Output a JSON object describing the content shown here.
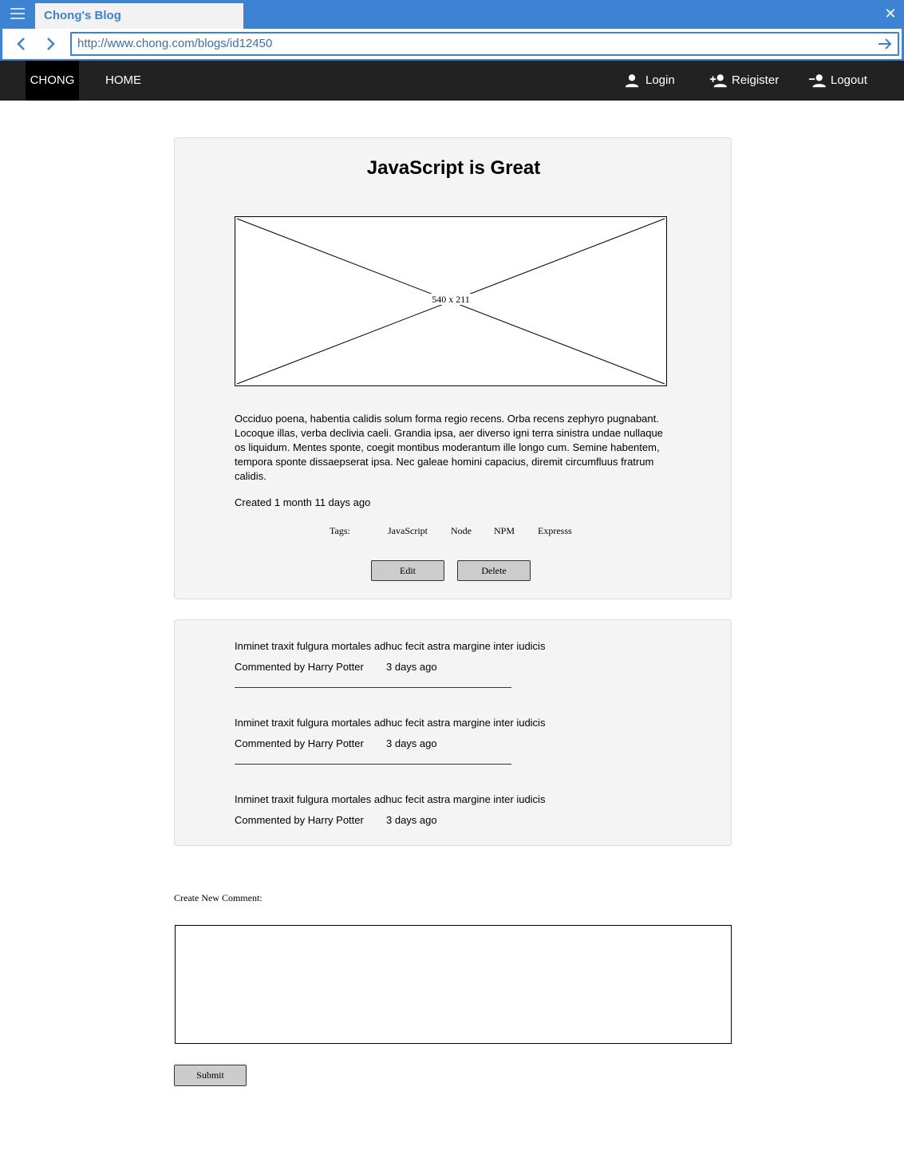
{
  "browser": {
    "tab_title": "Chong's Blog",
    "url": "http://www.chong.com/blogs/id12450"
  },
  "nav": {
    "brand": "CHONG",
    "home": "HOME",
    "login": "Login",
    "register": "Reigister",
    "logout": "Logout"
  },
  "post": {
    "title": "JavaScript is Great",
    "image_placeholder": "540 x 211",
    "body": "Occiduo poena, habentia calidis solum forma regio recens. Orba recens zephyro pugnabant. Locoque illas,  verba declivia caeli. Grandia ipsa, aer diverso igni terra sinistra undae nullaque os liquidum. Mentes sponte, coegit montibus moderantum ille longo cum. Semine habentem, tempora sponte dissaepserat ipsa. Nec galeae homini capacius, diremit circumfluus fratrum calidis.",
    "created": "Created 1 month 11 days ago",
    "tags_label": "Tags:",
    "tags": [
      "JavaScript",
      "Node",
      "NPM",
      "Expresss"
    ],
    "edit_label": "Edit",
    "delete_label": "Delete"
  },
  "comments": [
    {
      "text": "Inminet traxit fulgura mortales adhuc fecit astra margine inter iudicis",
      "author": "Commented by Harry Potter",
      "time": "3 days ago"
    },
    {
      "text": "Inminet traxit fulgura mortales adhuc fecit astra margine inter iudicis",
      "author": "Commented by Harry Potter",
      "time": "3 days ago"
    },
    {
      "text": "Inminet traxit fulgura mortales adhuc fecit astra margine inter iudicis",
      "author": "Commented by Harry Potter",
      "time": "3 days ago"
    }
  ],
  "new_comment": {
    "label": "Create New Comment:",
    "value": "",
    "submit_label": "Submit"
  }
}
